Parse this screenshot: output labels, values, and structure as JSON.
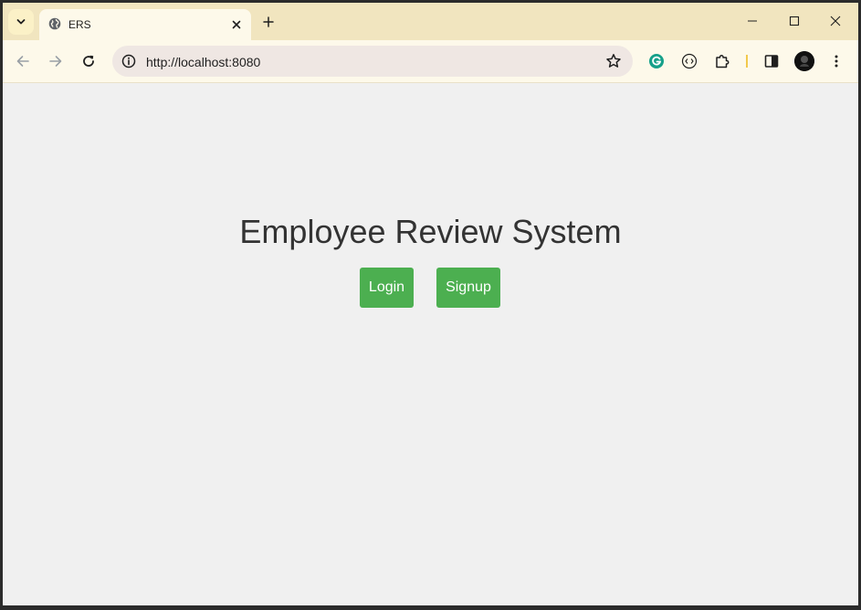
{
  "browser": {
    "tab": {
      "title": "ERS"
    },
    "address_bar": {
      "url": "http://localhost:8080"
    }
  },
  "page": {
    "title": "Employee Review System",
    "buttons": {
      "login_label": "Login",
      "signup_label": "Signup"
    },
    "colors": {
      "button_bg": "#4caf50",
      "page_bg": "#f0f0f0",
      "title_color": "#333333"
    }
  },
  "icons": [
    "tab-search-icon",
    "globe-icon",
    "close-icon",
    "plus-icon",
    "minimize-icon",
    "maximize-icon",
    "window-close-icon",
    "back-arrow-icon",
    "forward-arrow-icon",
    "reload-icon",
    "info-icon",
    "star-icon",
    "grammarly-icon",
    "extension-code-icon",
    "puzzle-icon",
    "side-panel-icon",
    "avatar",
    "more-menu-icon"
  ]
}
